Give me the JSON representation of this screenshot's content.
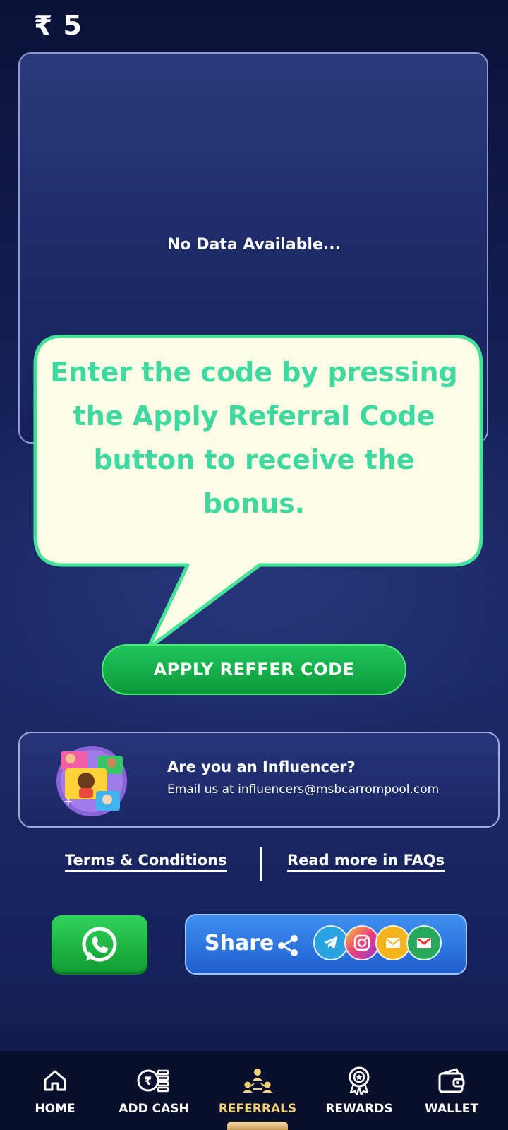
{
  "header": {
    "currency_symbol": "₹",
    "balance": "5"
  },
  "panel": {
    "empty_text": "No Data Available..."
  },
  "tooltip": {
    "text": "Enter the code by pressing the Apply Referral Code button to receive the bonus."
  },
  "apply_button": {
    "label": "APPLY REFFER CODE"
  },
  "influencer": {
    "title": "Are you an Influencer?",
    "email_text": "Email us at influencers@msbcarrompool.com"
  },
  "links": {
    "terms": "Terms & Conditions",
    "faqs": "Read more in FAQs"
  },
  "share": {
    "label": "Share",
    "icons": [
      "whatsapp-icon",
      "share-icon",
      "telegram-icon",
      "instagram-icon",
      "email-icon",
      "gmail-icon"
    ]
  },
  "bottom_nav": {
    "items": [
      {
        "label": "HOME",
        "icon": "home-icon"
      },
      {
        "label": "ADD CASH",
        "icon": "add-cash-icon"
      },
      {
        "label": "REFERRALS",
        "icon": "referrals-icon"
      },
      {
        "label": "REWARDS",
        "icon": "rewards-icon"
      },
      {
        "label": "WALLET",
        "icon": "wallet-icon"
      }
    ],
    "active": "REFERRALS"
  },
  "colors": {
    "tooltip_text": "#3dd9a0",
    "tooltip_bg": "#fdfde6",
    "tooltip_border": "#45e39a",
    "apply_green": "#12a843",
    "share_blue": "#2f7ae5",
    "nav_active": "#f3d27a"
  }
}
